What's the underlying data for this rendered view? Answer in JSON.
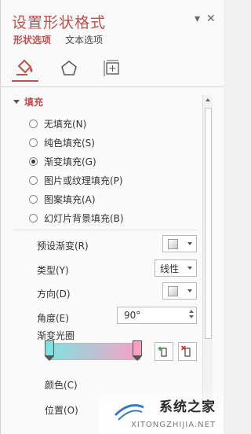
{
  "pane": {
    "title": "设置形状格式",
    "pin_glyph": "▾",
    "close_glyph": "✕",
    "tabs": [
      {
        "label": "形状选项",
        "active": true
      },
      {
        "label": "文本选项",
        "active": false
      }
    ],
    "icon_tabs": [
      "fill-line-icon",
      "effects-pentagon-icon",
      "size-properties-icon"
    ]
  },
  "fill": {
    "section_label": "填充",
    "options": [
      {
        "label": "无填充(N)",
        "checked": false
      },
      {
        "label": "纯色填充(S)",
        "checked": false
      },
      {
        "label": "渐变填充(G)",
        "checked": true
      },
      {
        "label": "图片或纹理填充(P)",
        "checked": false
      },
      {
        "label": "图案填充(A)",
        "checked": false
      },
      {
        "label": "幻灯片背景填充(B)",
        "checked": false
      }
    ],
    "preset_label": "预设渐变(R)",
    "type_label": "类型(Y)",
    "type_value": "线性",
    "direction_label": "方向(D)",
    "angle_label": "角度(E)",
    "angle_value": "90°",
    "stops_label": "渐变光圈",
    "color_label": "颜色(C)",
    "position_label": "位置(O)"
  },
  "colors": {
    "accent": "#c0504d",
    "gradient_start": "#7fe2df",
    "gradient_end": "#f8a1c4"
  },
  "watermark": {
    "text": "系统之家",
    "sub": "XITONGZHIJIA.NET"
  }
}
